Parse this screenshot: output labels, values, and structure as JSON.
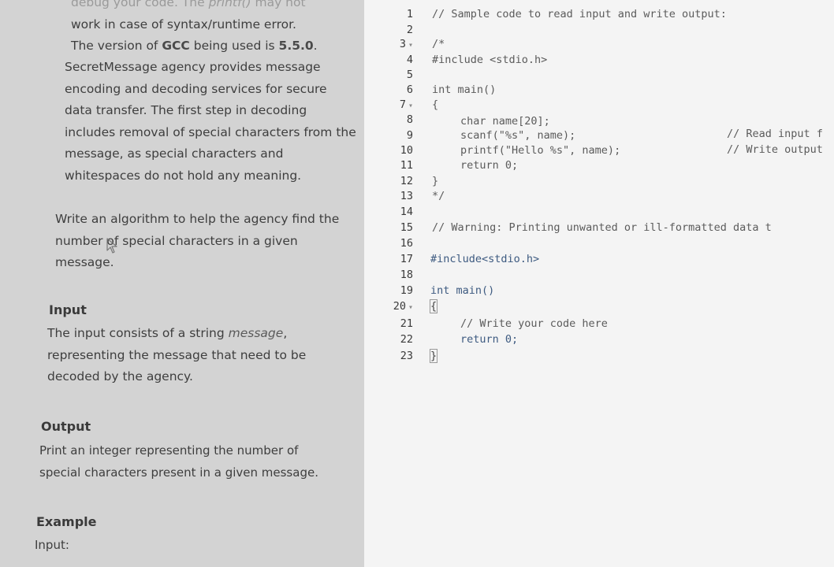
{
  "problem": {
    "intro_line1_prefix": "debug your code. The ",
    "intro_line1_func": "printf()",
    "intro_line1_suffix": " may not",
    "intro_line2": "work in case of syntax/runtime error.",
    "gcc_prefix": "The version of ",
    "gcc_name": "GCC",
    "gcc_middle": " being used is ",
    "gcc_version": "5.5.0",
    "gcc_suffix": ".",
    "desc_lines": [
      "SecretMessage agency provides message",
      "encoding and decoding services for secure",
      "data transfer. The first step in decoding",
      "includes removal of special characters from the",
      "message, as special characters and",
      "whitespaces do not hold any meaning."
    ],
    "task_lines": [
      "Write an algorithm to help the agency find the",
      "number of special characters in a given",
      "message."
    ],
    "input_heading": "Input",
    "input_line1_prefix": "The input consists of a string ",
    "input_line1_em": "message",
    "input_line1_suffix": ",",
    "input_lines_rest": [
      "representing the message that need to be",
      "decoded by the agency."
    ],
    "output_heading": "Output",
    "output_lines": [
      "Print an integer representing the number of",
      "special characters present in a given message."
    ],
    "example_heading": "Example",
    "example_input_label": "Input:"
  },
  "editor": {
    "line_numbers": [
      "1",
      "2",
      "3",
      "4",
      "5",
      "6",
      "7",
      "8",
      "9",
      "10",
      "11",
      "12",
      "13",
      "14",
      "15",
      "16",
      "17",
      "18",
      "19",
      "20",
      "21",
      "22",
      "23"
    ],
    "fold_marker": "▾",
    "lines": {
      "l1": "// Sample code to read input and write output:",
      "l3": "/*",
      "l4": "#include <stdio.h>",
      "l6": "int main()",
      "l7": "{",
      "l8": "char name[20];",
      "l9": "scanf(\"%s\", name);",
      "l9_comment": "// Read input f",
      "l10": "printf(\"Hello %s\", name);",
      "l10_comment": "// Write output",
      "l11": "return 0;",
      "l12": "}",
      "l13": "*/",
      "l15": "// Warning: Printing unwanted or ill-formatted data t",
      "l17": "#include<stdio.h>",
      "l19": "int main()",
      "l20": "{",
      "l21": "// Write your code here",
      "l22": "return 0;",
      "l23": "}"
    }
  }
}
